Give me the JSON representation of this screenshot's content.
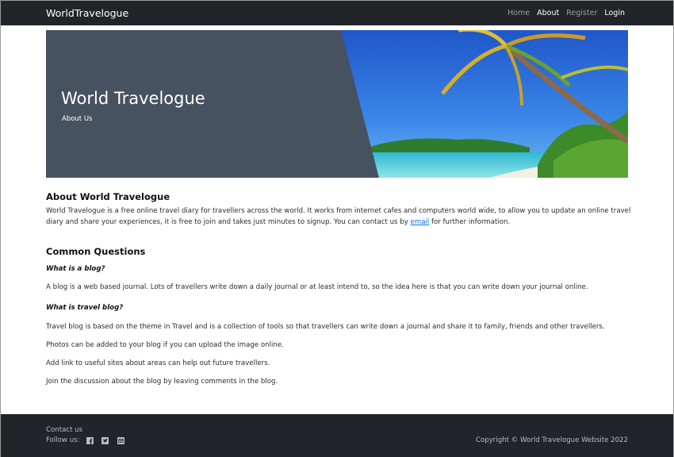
{
  "navbar": {
    "brand": "WorldTravelogue",
    "links": [
      "Home",
      "About",
      "Register",
      "Login"
    ]
  },
  "hero": {
    "title": "World Travelogue",
    "subtitle": "About Us"
  },
  "about": {
    "heading": "About World Travelogue",
    "text_before_link": "World Travelogue is a free online travel diary for travellers across the world. It works from internet cafes and computers world wide, to allow you to update an online travel diary and share your experiences, it is free to join and takes just minutes to signup. You can contact us by ",
    "link_text": "email",
    "text_after_link": " for further information."
  },
  "faq": {
    "heading": "Common Questions",
    "q1": "What is a blog?",
    "a1": "A blog is a web based journal. Lots of travellers write down a daily journal or at least intend to, so the idea here is that you can write down your journal online.",
    "q2": "What is travel blog?",
    "a2_1": "Travel blog is based on the theme in Travel and is a collection of tools so that travellers can write down a journal and share it to family, friends and other travellers.",
    "a2_2": "Photos can be added to your blog if you can upload the image online.",
    "a2_3": "Add link to useful sites about areas can help out future travellers.",
    "a2_4": "Join the discussion about the blog by leaving comments in the blog."
  },
  "footer": {
    "contact": "Contact us",
    "follow": "Follow us:",
    "social_icons": [
      "facebook-icon",
      "twitter-icon",
      "email-icon"
    ],
    "copyright": "Copyright © World Travelogue Website 2022"
  },
  "colors": {
    "navbar_bg": "#212529",
    "hero_panel": "#475260",
    "link": "#0d6efd"
  }
}
